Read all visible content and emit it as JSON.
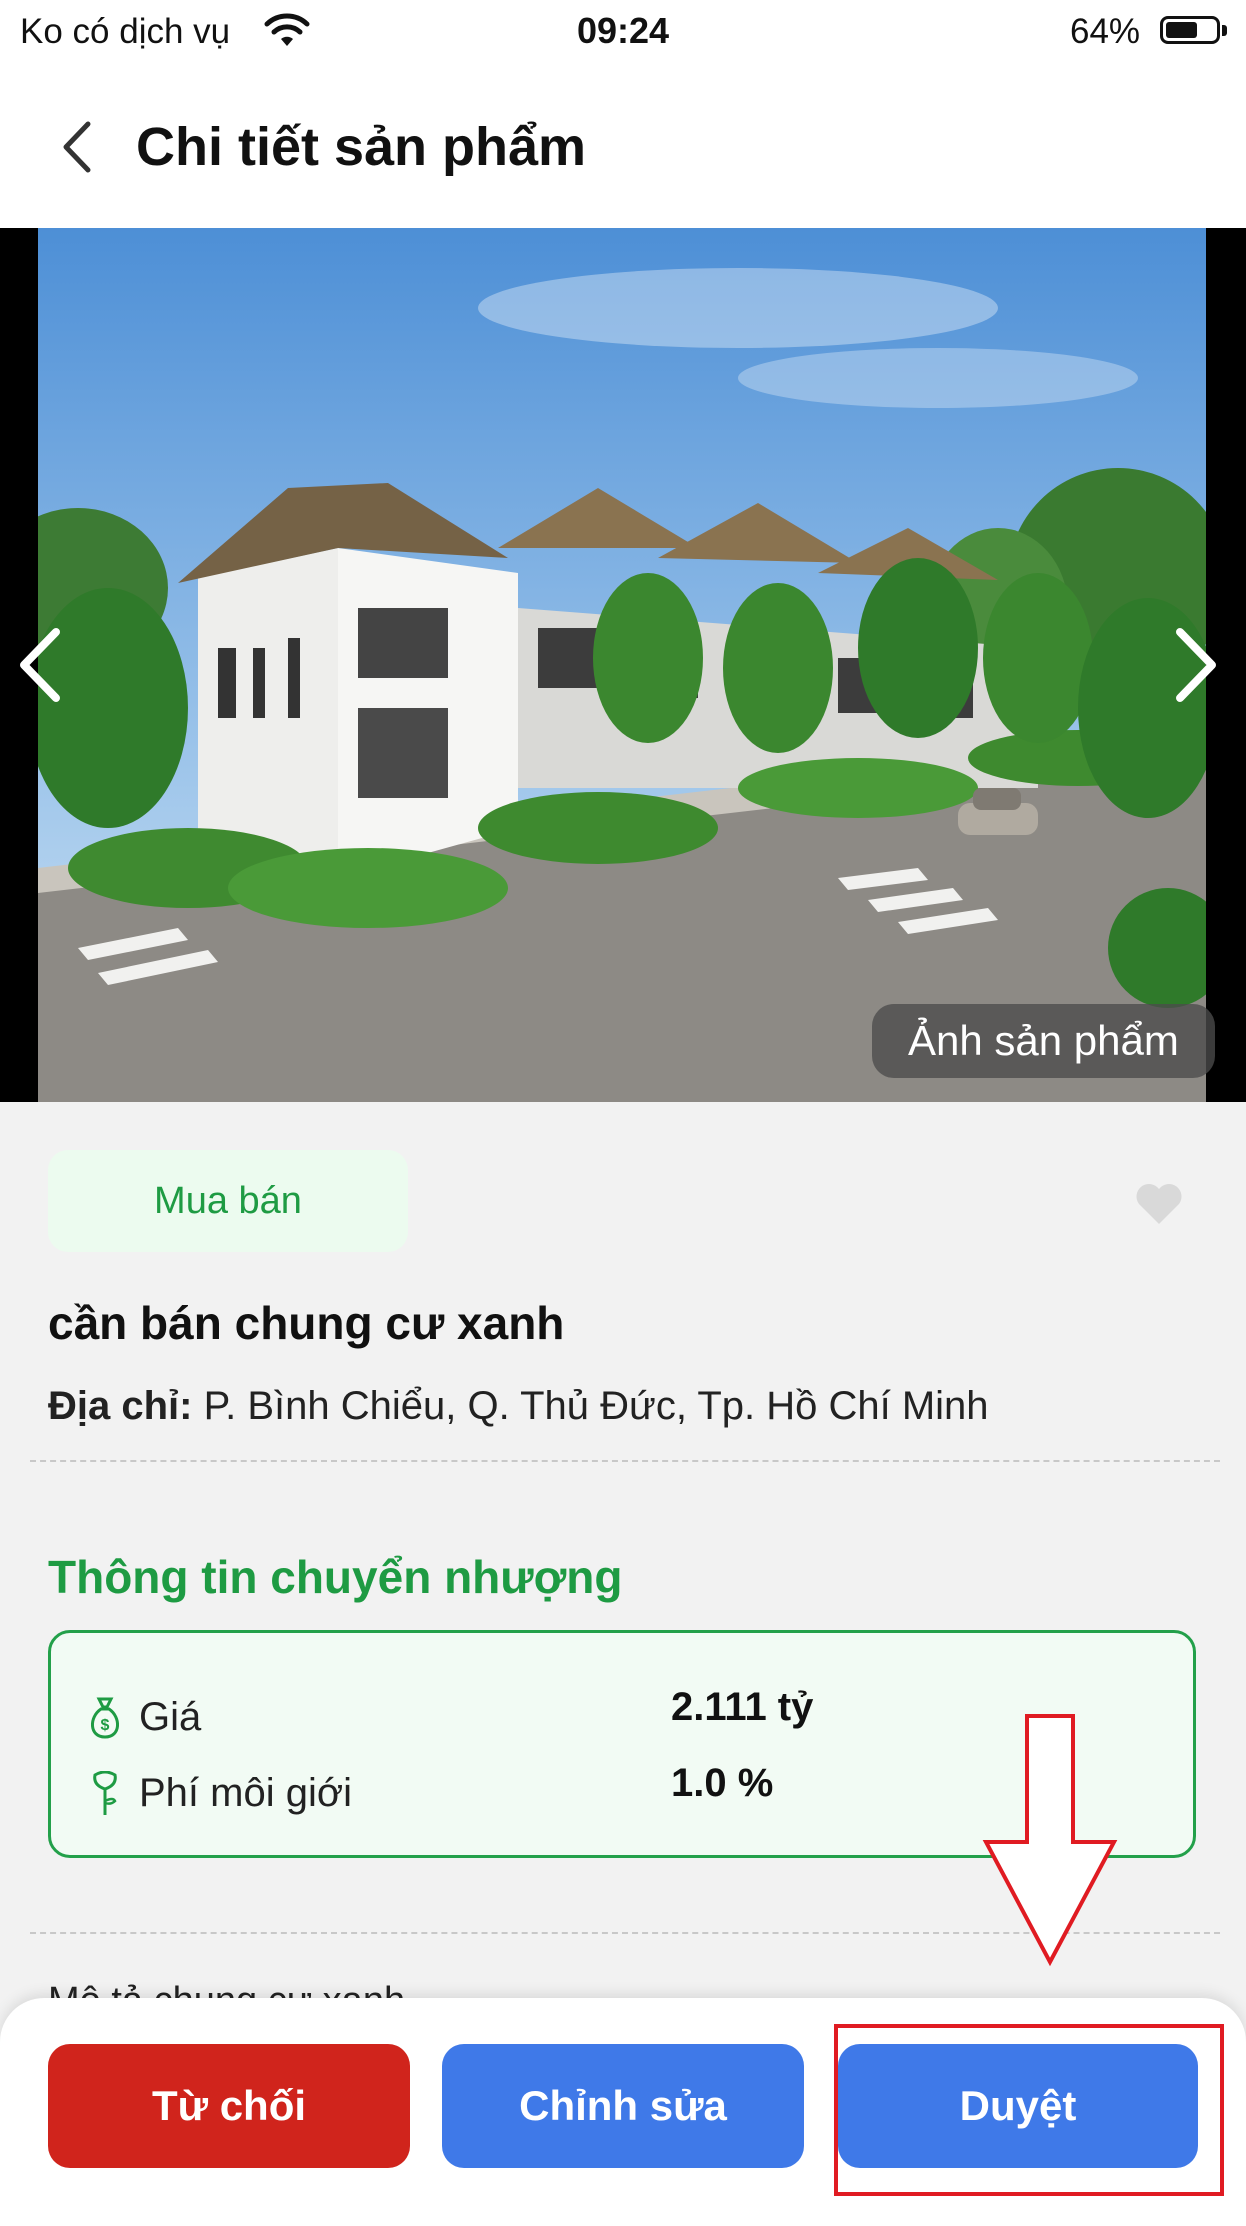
{
  "status_bar": {
    "carrier": "Ko có dịch vụ",
    "time": "09:24",
    "battery": "64%",
    "battery_level": 0.64
  },
  "header": {
    "title": "Chi tiết sản phẩm",
    "back_icon": "chevron-left-icon"
  },
  "gallery": {
    "caption": "Ảnh sản phẩm",
    "prev_icon": "chevron-left-icon",
    "next_icon": "chevron-right-icon"
  },
  "product": {
    "tag": "Mua bán",
    "title": "cần bán chung cư xanh",
    "address_label": "Địa chỉ:",
    "address_value": "P. Bình Chiểu, Q. Thủ Đức, Tp. Hồ Chí Minh",
    "favorite_icon": "heart-icon"
  },
  "transfer_info": {
    "title": "Thông tin chuyển nhượng",
    "rows": [
      {
        "icon": "money-bag-icon",
        "label": "Giá",
        "value": "2.111 tỷ"
      },
      {
        "icon": "rose-icon",
        "label": "Phí môi giới",
        "value": "1.0 %"
      }
    ]
  },
  "partially_hidden_text": "Mô tả chung cư xanh",
  "actions": {
    "reject": "Từ chối",
    "edit": "Chỉnh sửa",
    "approve": "Duyệt"
  },
  "colors": {
    "green": "#1e9b43",
    "blue": "#3f79e8",
    "red": "#d0241c",
    "annotation": "#e01b22"
  }
}
